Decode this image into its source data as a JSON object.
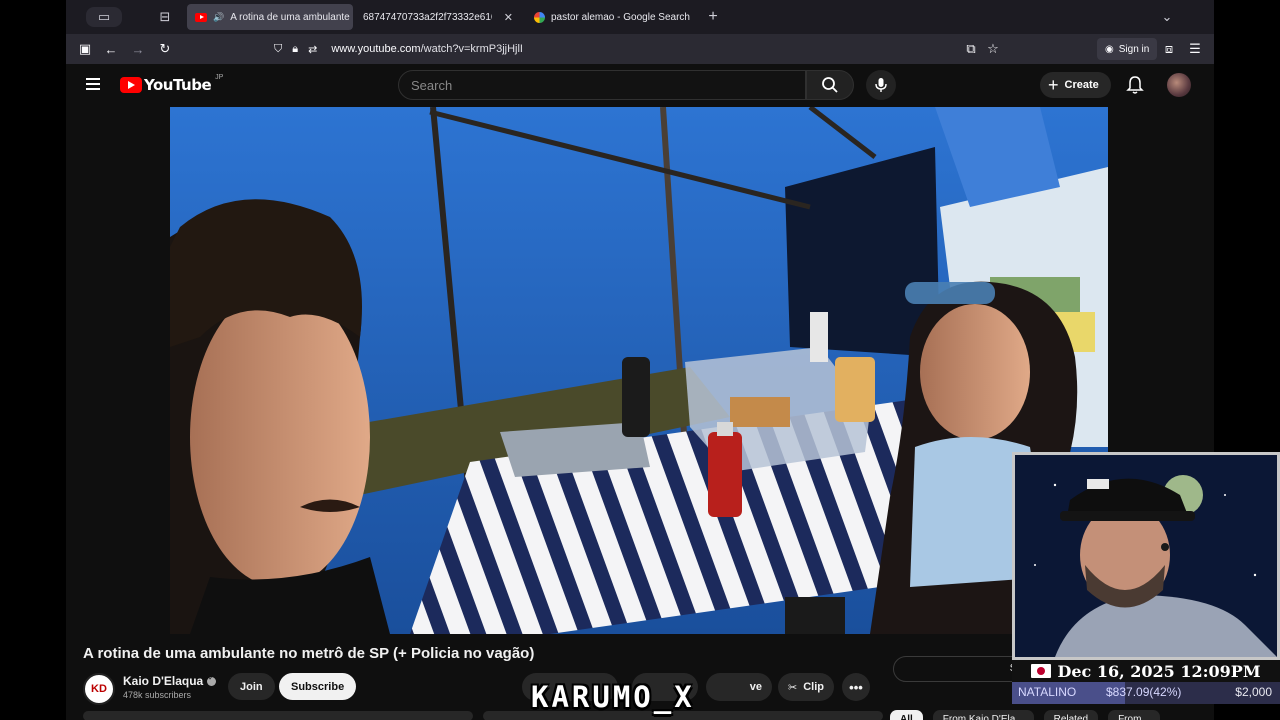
{
  "browser": {
    "tabs": [
      {
        "title": "A rotina de uma ambulante",
        "active": true,
        "favicon": "youtube-icon"
      },
      {
        "title": "68747470733a2f2f73332e616d617",
        "active": false,
        "favicon": "none"
      },
      {
        "title": "pastor alemao - Google Search",
        "active": false,
        "favicon": "google-icon"
      }
    ],
    "url_host": "www.youtube.com",
    "url_path": "/watch?v=krmP3jjHjlI",
    "signin_label": "Sign in"
  },
  "youtube": {
    "logo_text": "YouTube",
    "region": "JP",
    "search_placeholder": "Search",
    "create_label": "Create"
  },
  "video": {
    "title": "A rotina de uma ambulante no metrô de SP (+ Policia no vagão)",
    "channel_name": "Kaio D'Elaqua",
    "channel_avatar_text": "KD",
    "subscribers": "478k subscribers",
    "join_label": "Join",
    "subscribe_label": "Subscribe",
    "save_label": "ve",
    "clip_label": "Clip",
    "share_box_text": "Sh",
    "chips": [
      "All",
      "From Kaio D'Ela...",
      "Related",
      "From..."
    ]
  },
  "overlay": {
    "watermark": "KARUMO_X",
    "datetime": "Dec 16, 2025 12:09PM",
    "goal_name": "NATALINO",
    "goal_value": "$837.09(42%)",
    "goal_progress": 0.42,
    "goal_target": "$2,000"
  },
  "colors": {
    "youtube_red": "#ff0000",
    "tent_blue": "#1f62b6",
    "goal_bar": "#2c2d4a"
  }
}
